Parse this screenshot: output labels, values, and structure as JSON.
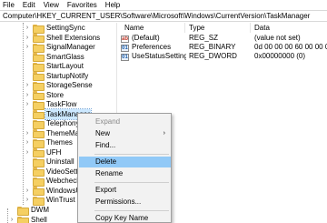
{
  "menu": [
    "File",
    "Edit",
    "View",
    "Favorites",
    "Help"
  ],
  "address": "Computer\\HKEY_CURRENT_USER\\Software\\Microsoft\\Windows\\CurrentVersion\\TaskManager",
  "tree": {
    "items": [
      {
        "label": "SettingSync",
        "expandable": true
      },
      {
        "label": "Shell Extensions",
        "expandable": true
      },
      {
        "label": "SignalManager",
        "expandable": true
      },
      {
        "label": "SmartGlass",
        "expandable": false
      },
      {
        "label": "StartLayout",
        "expandable": false
      },
      {
        "label": "StartupNotify",
        "expandable": false
      },
      {
        "label": "StorageSense",
        "expandable": true
      },
      {
        "label": "Store",
        "expandable": true
      },
      {
        "label": "TaskFlow",
        "expandable": true
      },
      {
        "label": "TaskManager",
        "expandable": false,
        "selected": true
      },
      {
        "label": "Telephony",
        "expandable": false
      },
      {
        "label": "ThemeMan",
        "expandable": true
      },
      {
        "label": "Themes",
        "expandable": true
      },
      {
        "label": "UFH",
        "expandable": true
      },
      {
        "label": "Uninstall",
        "expandable": false
      },
      {
        "label": "VideoSettin",
        "expandable": false
      },
      {
        "label": "Webcheck",
        "expandable": false
      },
      {
        "label": "WindowsUp",
        "expandable": true
      },
      {
        "label": "WinTrust",
        "expandable": true
      }
    ],
    "bottom_items": [
      {
        "label": "DWM",
        "expandable": false
      },
      {
        "label": "Shell",
        "expandable": true
      }
    ]
  },
  "values": {
    "headers": {
      "name": "Name",
      "type": "Type",
      "data": "Data"
    },
    "rows": [
      {
        "icon": "ab",
        "kind": "string-value-icon",
        "name": "(Default)",
        "type": "REG_SZ",
        "data": "(value not set)"
      },
      {
        "icon": "01",
        "kind": "binary-value-icon",
        "name": "Preferences",
        "type": "REG_BINARY",
        "data": "0d 00 00 00 60 00 00 00 60 00"
      },
      {
        "icon": "01",
        "kind": "binary-value-icon",
        "name": "UseStatusSetting",
        "type": "REG_DWORD",
        "data": "0x00000000 (0)"
      }
    ]
  },
  "context_menu": {
    "expand": "Expand",
    "new": "New",
    "find": "Find...",
    "delete": "Delete",
    "rename": "Rename",
    "export": "Export",
    "permissions": "Permissions...",
    "copy_key_name": "Copy Key Name",
    "submenu_arrow": "›"
  },
  "colors": {
    "selection": "#cce8ff",
    "menu_hover": "#91c9f7",
    "folder": "#f5cf62"
  }
}
